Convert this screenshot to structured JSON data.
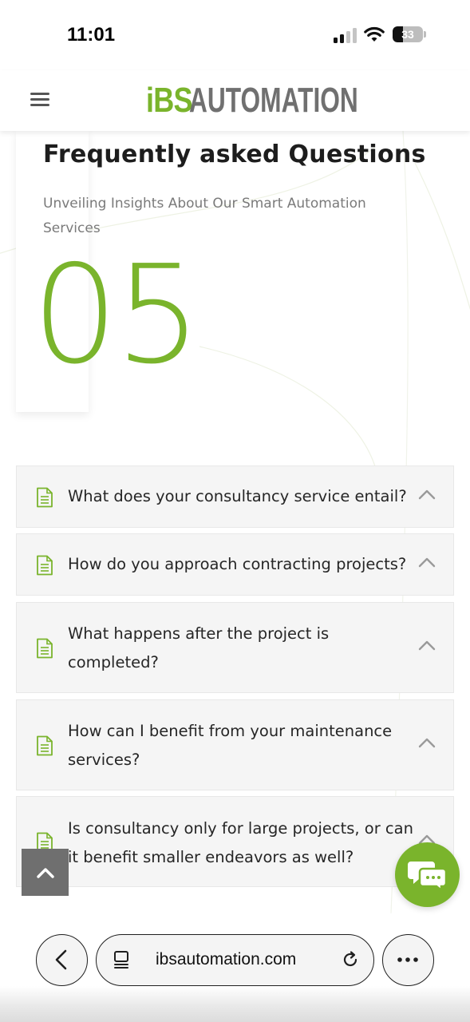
{
  "status_bar": {
    "time": "11:01",
    "battery_percent": "33",
    "battery_level": 0.33,
    "signal_bars_active": 2,
    "signal_bars_total": 4
  },
  "header": {
    "logo_part1": "iBS",
    "logo_part2": "AUTOMATION",
    "menu_icon": "hamburger-menu-icon"
  },
  "faq": {
    "title": "Frequently asked Questions",
    "subtitle": "Unveiling Insights About Our Smart Automation Services",
    "big_number": "05",
    "items": [
      {
        "question": "What does your consultancy service entail?",
        "icon": "document-icon",
        "expand_icon": "chevron-up-icon"
      },
      {
        "question": "How do you approach contracting projects?",
        "icon": "document-icon",
        "expand_icon": "chevron-up-icon"
      },
      {
        "question": "What happens after the project is completed?",
        "icon": "document-icon",
        "expand_icon": "chevron-up-icon"
      },
      {
        "question": "How can I benefit from your maintenance services?",
        "icon": "document-icon",
        "expand_icon": "chevron-up-icon"
      },
      {
        "question": "Is consultancy only for large projects, or can it benefit smaller endeavors as well?",
        "icon": "document-icon",
        "expand_icon": "chevron-up-icon"
      }
    ]
  },
  "floating": {
    "scroll_top_icon": "arrow-up-icon",
    "chat_icon": "chat-bubbles-icon"
  },
  "browser": {
    "url": "ibsautomation.com",
    "back_icon": "chevron-left-icon",
    "tabs_icon": "page-tabs-icon",
    "reload_icon": "reload-icon",
    "more_icon": "more-dots-icon"
  },
  "colors": {
    "brand_green": "#7ab42c",
    "logo_gray": "#707070",
    "card_bg": "#f5f5f5",
    "text_dark": "#262626",
    "text_muted": "#7a7a7a"
  }
}
